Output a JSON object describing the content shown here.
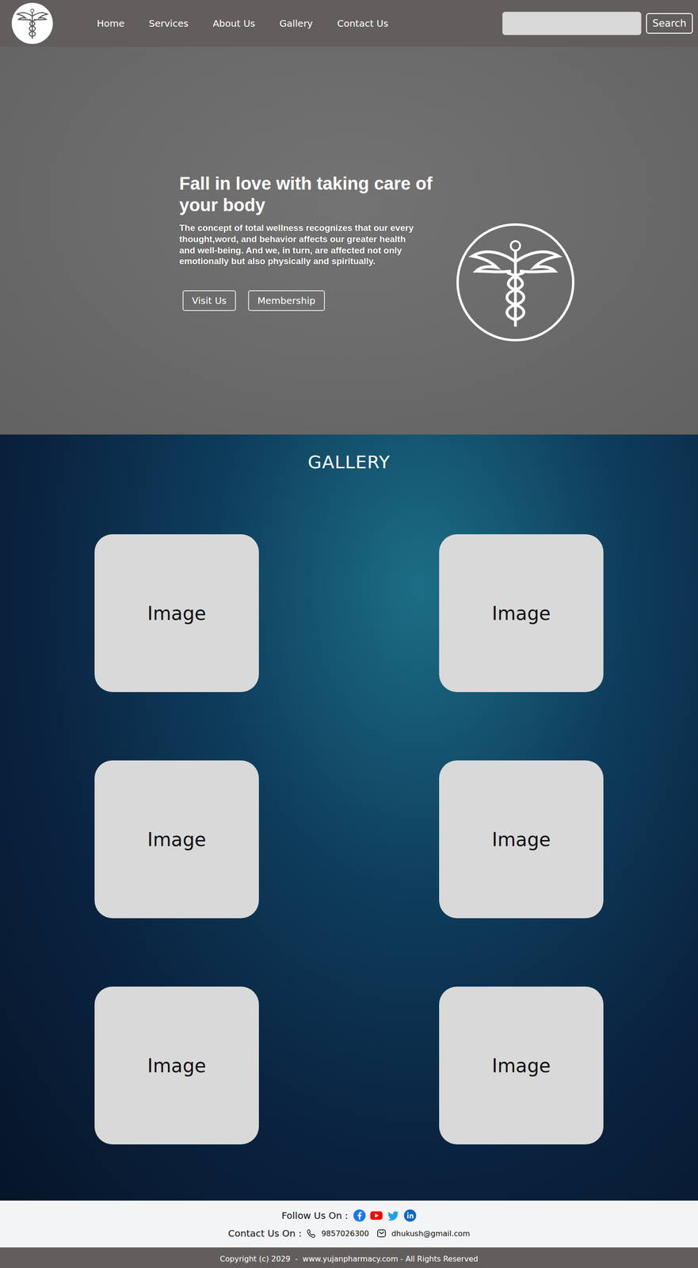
{
  "nav": {
    "links": [
      "Home",
      "Services",
      "About Us",
      "Gallery",
      "Contact Us"
    ]
  },
  "search": {
    "placeholder": "",
    "button": "Search"
  },
  "hero": {
    "title": "Fall in love with taking care of your body",
    "paragraph": "The concept of total wellness recognizes that our every thought,word, and behavior affects our greater health and well-being. And we, in turn, are affected not only emotionally but also physically and spiritually.",
    "buttons": [
      "Visit Us",
      "Membership"
    ]
  },
  "gallery": {
    "heading": "GALLERY",
    "items": [
      "Image",
      "Image",
      "Image",
      "Image",
      "Image",
      "Image"
    ]
  },
  "footer": {
    "follow_label": "Follow Us On :",
    "social": [
      {
        "kind": "facebook",
        "color": "#1877f2"
      },
      {
        "kind": "youtube",
        "color": "#ff0000"
      },
      {
        "kind": "twitter",
        "color": "#1da1f2"
      },
      {
        "kind": "linkedin",
        "color": "#0a66c2"
      }
    ],
    "contact_label": "Contact Us On :",
    "phone": "9857026300",
    "email": "dhukush@gmail.com",
    "copyright": "Copyright (c) 2029  -  www.yujanpharmacy.com - All Rights Reserved"
  }
}
